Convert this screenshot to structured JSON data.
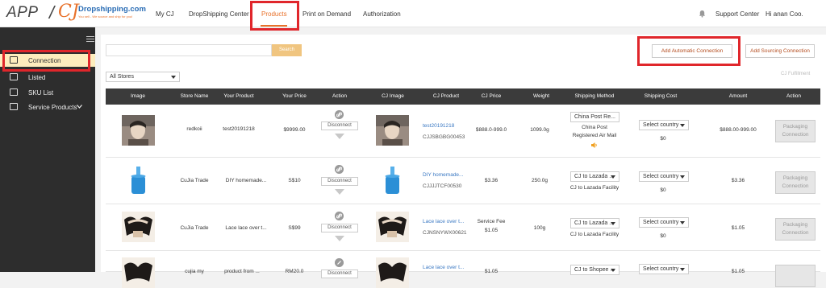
{
  "header": {
    "logo_app": "APP",
    "logo_slash": "/",
    "logo_cj": "CJ",
    "logo_site": "Dropshipping.com",
    "logo_tagline": "You sell - We source and ship for you!",
    "nav": [
      "My CJ",
      "DropShipping Center",
      "Products",
      "Print on Demand",
      "Authorization"
    ],
    "active_nav": "Products",
    "support": "Support Center",
    "greeting": "Hi anan Coo."
  },
  "sidebar": {
    "items": [
      {
        "label": "Connection",
        "icon": "connection-icon",
        "active": true
      },
      {
        "label": "Listed",
        "icon": "listed-icon"
      },
      {
        "label": "SKU List",
        "icon": "sku-icon"
      },
      {
        "label": "Service Products",
        "icon": "service-icon"
      }
    ]
  },
  "toolbar": {
    "search_placeholder": "",
    "search_button": "Search",
    "auto_connect": "Add Automatic Connection",
    "sourcing_connect": "Add Sourcing Connection",
    "store_filter": "All Stores",
    "cj_fulfillment": "CJ Fulfillment"
  },
  "table": {
    "columns": [
      "Image",
      "Store Name",
      "Your Product",
      "Your Price",
      "Action",
      "CJ Image",
      "CJ Product",
      "CJ Price",
      "Weight",
      "Shipping Method",
      "Shipping Cost",
      "Amount",
      "Action"
    ],
    "disconnect_label": "Disconnect",
    "packaging_label_1": "Packaging",
    "packaging_label_2": "Connection",
    "select_country": "Select country",
    "rows": [
      {
        "store": "redkoii",
        "product": "test20191218",
        "price": "$9999.00",
        "cj_product": "test20191218",
        "cj_sku": "CJJSBGBG00453",
        "cj_price": "$888.0-999.0",
        "weight": "1099.0g",
        "ship_select": "China Post Re...",
        "ship_name_1": "China Post",
        "ship_name_2": "Registered Air Mail",
        "cost": "$0",
        "amount": "$888.00-999.00"
      },
      {
        "store": "CuJia Trade",
        "product": "DIY homemade...",
        "price": "S$10",
        "cj_product": "DIY homemade...",
        "cj_sku": "CJJJJTCF00530",
        "cj_price": "$3.36",
        "weight": "250.0g",
        "ship_select": "CJ to Lazada ...",
        "ship_name_1": "CJ to Lazada Facility",
        "cost": "$0",
        "amount": "$3.36"
      },
      {
        "store": "CuJia Trade",
        "product": "Lace lace over t...",
        "price": "S$99",
        "cj_product": "Lace lace over t...",
        "cj_sku": "CJNSNYWX00621",
        "cj_price_1": "Service Fee",
        "cj_price_2": "$1.05",
        "weight": "100g",
        "ship_select": "CJ to Lazada ...",
        "ship_name_1": "CJ to Lazada Facility",
        "cost": "$0",
        "amount": "$1.05"
      },
      {
        "store": "cujia my",
        "product": "product from ...",
        "price": "RM20.0",
        "cj_product": "Lace lace over t...",
        "cj_price": "$1.05",
        "ship_select": "CJ to Shopee ...",
        "amount": "$1.05"
      }
    ]
  },
  "colors": {
    "accent": "#e8712a",
    "highlight": "#e0262b",
    "sidebar": "#2d2d2d",
    "active_item": "#fdedbd",
    "link": "#3a78c3"
  }
}
